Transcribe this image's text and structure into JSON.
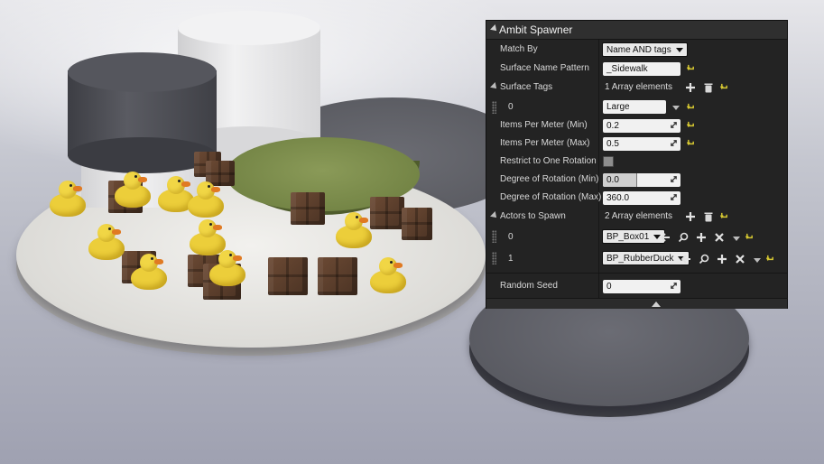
{
  "panel": {
    "title": "Ambit Spawner",
    "match_by": {
      "label": "Match By",
      "value": "Name AND tags"
    },
    "surface_name_pattern": {
      "label": "Surface Name Pattern",
      "value": "_Sidewalk"
    },
    "surface_tags": {
      "label": "Surface Tags",
      "count": "1 Array elements",
      "elements": [
        {
          "index": "0",
          "value": "Large"
        }
      ]
    },
    "items_per_meter_min": {
      "label": "Items Per Meter (Min)",
      "value": "0.2"
    },
    "items_per_meter_max": {
      "label": "Items Per Meter (Max)",
      "value": "0.5"
    },
    "restrict_rotation": {
      "label": "Restrict to One Rotation",
      "checked": false
    },
    "rotation_min": {
      "label": "Degree of Rotation (Min)",
      "value": "0.0"
    },
    "rotation_max": {
      "label": "Degree of Rotation (Max)",
      "value": "360.0"
    },
    "actors_to_spawn": {
      "label": "Actors to Spawn",
      "count": "2 Array elements",
      "elements": [
        {
          "index": "0",
          "value": "BP_Box01"
        },
        {
          "index": "1",
          "value": "BP_RubberDuck"
        }
      ]
    },
    "random_seed": {
      "label": "Random Seed",
      "value": "0"
    }
  },
  "icons": {
    "add": "plus-icon",
    "delete": "trash-icon",
    "reset": "reset-to-default-icon",
    "browse": "use-selected-arrow-icon",
    "search": "search-icon",
    "clear": "close-icon",
    "expand": "dropdown-arrow-icon"
  },
  "colors": {
    "reset_arrow": "#d6c832",
    "panel_bg": "#232323",
    "field_bg": "#f1f1f1"
  }
}
